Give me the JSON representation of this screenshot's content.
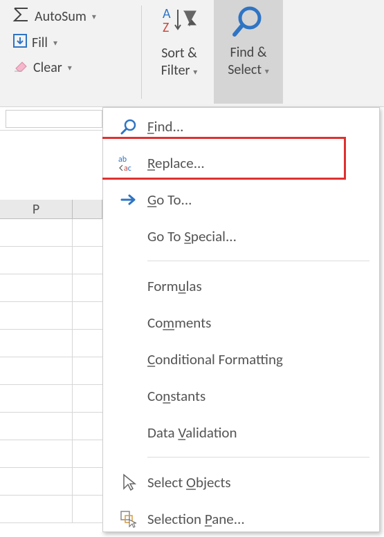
{
  "ribbon": {
    "autosum_label": "AutoSum",
    "fill_label": "Fill",
    "clear_label": "Clear",
    "sort_filter_line1": "Sort &",
    "sort_filter_line2": "Filter",
    "find_select_line1": "Find &",
    "find_select_line2": "Select"
  },
  "menu": {
    "find": "Find...",
    "replace": "Replace...",
    "goto": "Go To...",
    "goto_special": "Go To Special...",
    "formulas": "Formulas",
    "comments": "Comments",
    "conditional_formatting": "Conditional Formatting",
    "constants": "Constants",
    "data_validation": "Data Validation",
    "select_objects": "Select Objects",
    "selection_pane": "Selection Pane..."
  },
  "sheet": {
    "column_P": "P"
  }
}
